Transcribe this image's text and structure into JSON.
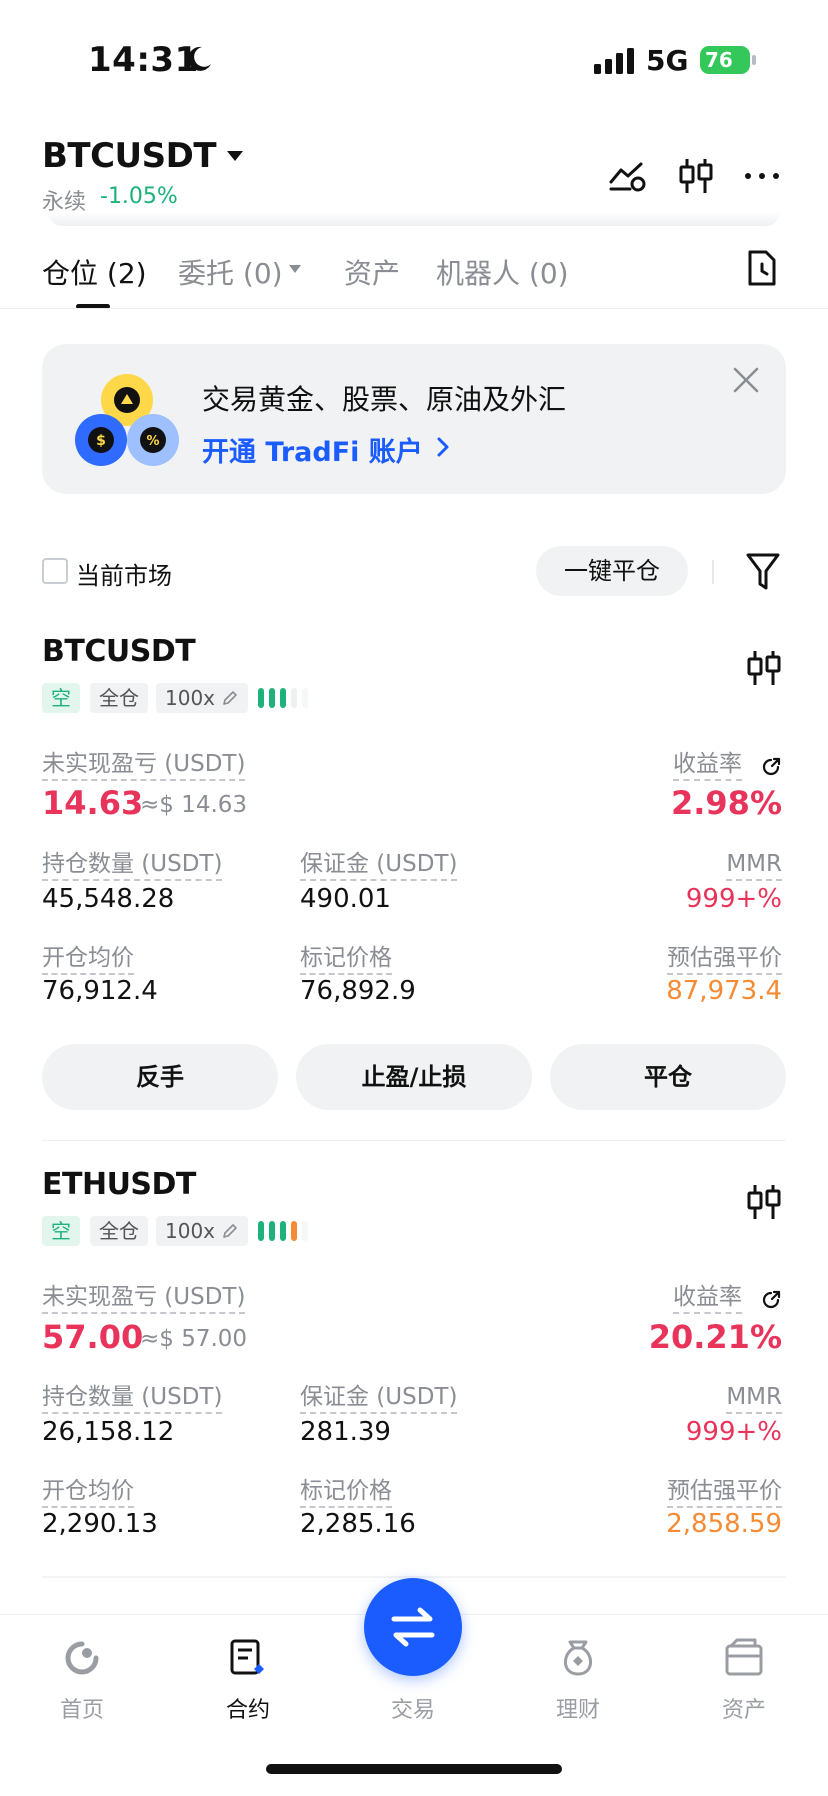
{
  "status_bar": {
    "time": "14:31",
    "network": "5G",
    "battery": "76"
  },
  "header": {
    "symbol": "BTCUSDT",
    "contract_type": "永续",
    "change": "-1.05%"
  },
  "tabs": [
    {
      "label": "仓位 (2)",
      "active": true
    },
    {
      "label": "委托 (0)",
      "active": false
    },
    {
      "label": "资产",
      "active": false
    },
    {
      "label": "机器人 (0)",
      "active": false
    }
  ],
  "banner": {
    "title": "交易黄金、股票、原油及外汇",
    "link": "开通 TradFi 账户"
  },
  "filter": {
    "current_market": "当前市场",
    "close_all": "一键平仓"
  },
  "positions": [
    {
      "symbol": "BTCUSDT",
      "side": "空",
      "margin_mode": "全仓",
      "leverage": "100x",
      "pnl_label": "未实现盈亏 (USDT)",
      "pnl": "14.63",
      "pnl_usd": "≈$ 14.63",
      "roe_label": "收益率",
      "roe": "2.98%",
      "size_label": "持仓数量 (USDT)",
      "size": "45,548.28",
      "margin_label": "保证金 (USDT)",
      "margin": "490.01",
      "mmr_label": "MMR",
      "mmr": "999+%",
      "entry_label": "开仓均价",
      "entry": "76,912.4",
      "mark_label": "标记价格",
      "mark": "76,892.9",
      "liq_label": "预估强平价",
      "liq": "87,973.4",
      "risk_bars": 3
    },
    {
      "symbol": "ETHUSDT",
      "side": "空",
      "margin_mode": "全仓",
      "leverage": "100x",
      "pnl_label": "未实现盈亏 (USDT)",
      "pnl": "57.00",
      "pnl_usd": "≈$ 57.00",
      "roe_label": "收益率",
      "roe": "20.21%",
      "size_label": "持仓数量 (USDT)",
      "size": "26,158.12",
      "margin_label": "保证金 (USDT)",
      "margin": "281.39",
      "mmr_label": "MMR",
      "mmr": "999+%",
      "entry_label": "开仓均价",
      "entry": "2,290.13",
      "mark_label": "标记价格",
      "mark": "2,285.16",
      "liq_label": "预估强平价",
      "liq": "2,858.59",
      "risk_bars": 4
    }
  ],
  "actions": {
    "reverse": "反手",
    "tpsl": "止盈/止损",
    "close": "平仓"
  },
  "nav": [
    {
      "label": "首页",
      "icon": "home-icon",
      "active": false
    },
    {
      "label": "合约",
      "icon": "futures-icon",
      "active": true
    },
    {
      "label": "交易",
      "icon": "trade-icon",
      "active": false
    },
    {
      "label": "理财",
      "icon": "earn-icon",
      "active": false
    },
    {
      "label": "资产",
      "icon": "wallet-icon",
      "active": false
    }
  ],
  "colors": {
    "up": "#1cb27a",
    "down": "#e8335a",
    "liq": "#f58b35",
    "accent": "#1a5cff"
  }
}
